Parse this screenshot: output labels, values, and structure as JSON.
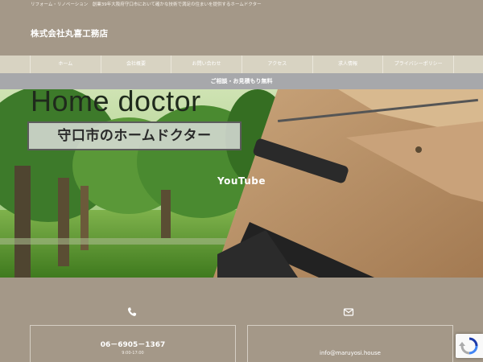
{
  "topbar": {
    "text": "リフォーム・リノベーション　創業39年大阪府守口市において確かな技術で満足の住まいを提供するホームドクター"
  },
  "header": {
    "site_title": "株式会社丸喜工務店"
  },
  "nav": {
    "items": [
      {
        "label": "ホーム"
      },
      {
        "label": "会社概要"
      },
      {
        "label": "お問い合わせ"
      },
      {
        "label": "アクセス"
      },
      {
        "label": "求人情報"
      },
      {
        "label": "プライバシーポリシー"
      }
    ]
  },
  "consult_banner": {
    "label": "ご相談・お見積もり無料"
  },
  "hero": {
    "headline": "Home doctor",
    "badge": "守口市のホームドクター",
    "video_label": "YouTube"
  },
  "contact": {
    "phone_icon": "phone-icon",
    "mail_icon": "envelope-icon",
    "phone_number": "06－6905－1367",
    "phone_hours": "9:00-17:00",
    "email": "info@maruyosi.house"
  },
  "colors": {
    "brand_brown": "#a49888",
    "nav_beige": "#d8d3c2",
    "consult_gray": "#a7a8ab"
  }
}
